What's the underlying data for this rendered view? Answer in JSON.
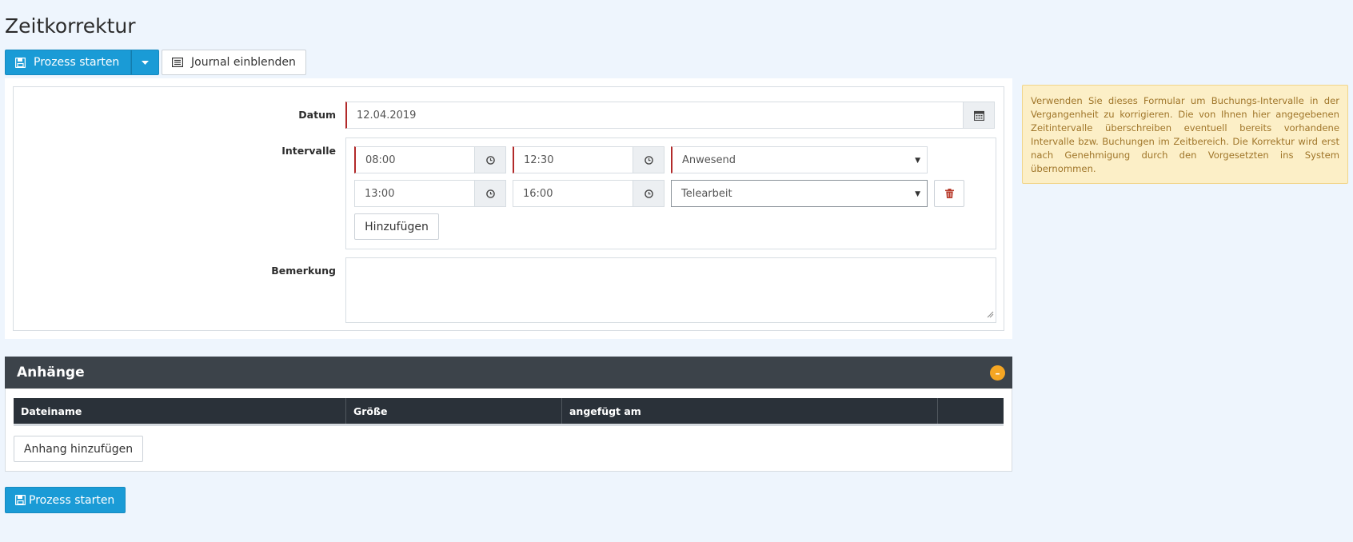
{
  "page": {
    "title": "Zeitkorrektur"
  },
  "toolbar": {
    "start_label": "Prozess starten",
    "journal_label": "Journal einblenden"
  },
  "form": {
    "date_label": "Datum",
    "date_value": "12.04.2019",
    "intervals_label": "Intervalle",
    "intervals": [
      {
        "from": "08:00",
        "to": "12:30",
        "type": "Anwesend"
      },
      {
        "from": "13:00",
        "to": "16:00",
        "type": "Telearbeit"
      }
    ],
    "add_label": "Hinzufügen",
    "remark_label": "Bemerkung",
    "remark_value": ""
  },
  "info": {
    "text": "Verwenden Sie dieses Formular um Buchungs-Intervalle in der Vergangenheit zu korrigieren. Die von Ihnen hier angegebenen Zeitintervalle überschreiben eventuell bereits vorhandene Intervalle bzw. Buchungen im Zeitbereich. Die Korrektur wird erst nach Genehmigung durch den Vorgesetzten ins System übernommen."
  },
  "attachments": {
    "title": "Anhänge",
    "columns": [
      "Dateiname",
      "Größe",
      "angefügt am",
      ""
    ],
    "add_label": "Anhang hinzufügen"
  },
  "footer": {
    "start_label": "Prozess starten"
  },
  "colors": {
    "primary": "#1a9bd6",
    "required_marker": "#b22a2a",
    "panel_header": "#3c434a",
    "collapse_accent": "#f5a623",
    "info_bg": "#fcefc7"
  }
}
